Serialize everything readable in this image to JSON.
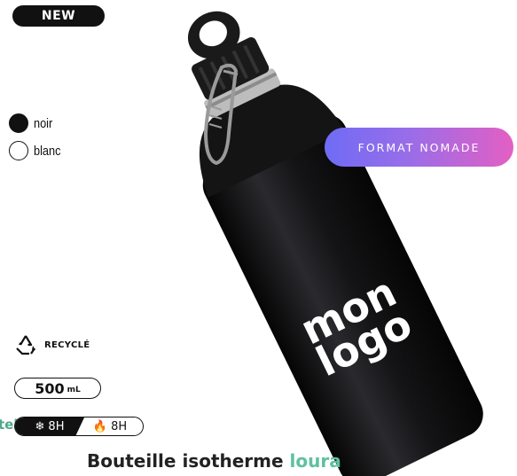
{
  "badge": {
    "new_label": "NEW"
  },
  "colors": [
    {
      "label": "noir",
      "swatch": "#111111"
    },
    {
      "label": "blanc",
      "swatch": "#ffffff"
    }
  ],
  "format_badge": {
    "label": "FORMAT NOMADE"
  },
  "bottle": {
    "print_line1": "mon",
    "print_line2": "logo"
  },
  "recycle": {
    "label": "RECYCLÉ",
    "icon": "recycle-icon"
  },
  "volume": {
    "amount": "500",
    "unit": "mL"
  },
  "temperature": {
    "cold_label": "8H",
    "cold_icon": "snowflake-icon",
    "hot_label": "8H",
    "hot_icon": "flame-icon"
  },
  "cut_text": "tel",
  "product": {
    "title": "Bouteille isotherme",
    "title_highlight": "loura"
  },
  "theme": {
    "accent_green": "#5fc0a2",
    "gradient_start": "#6f6cf6",
    "gradient_end": "#e35fc4"
  }
}
